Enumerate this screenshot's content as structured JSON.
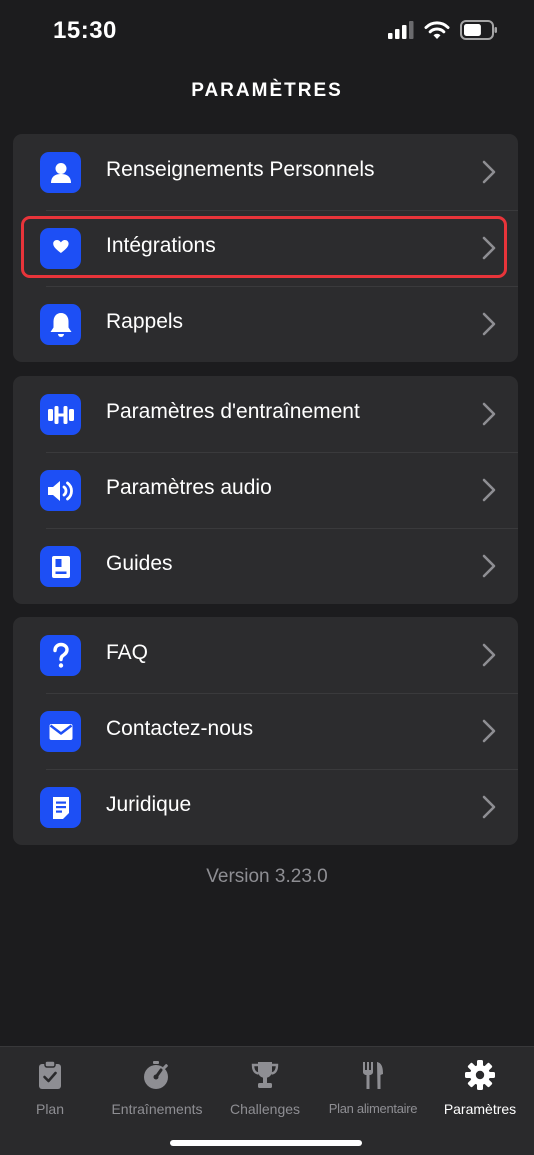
{
  "status_bar": {
    "time": "15:30",
    "icons": [
      "signal-icon",
      "wifi-icon",
      "battery-icon"
    ],
    "battery_level": 0.65
  },
  "header": {
    "title": "PARAMÈTRES"
  },
  "colors": {
    "background": "#1c1c1e",
    "card": "#2c2c2e",
    "icon_accent": "#1d4ff5",
    "highlight": "#e8343a",
    "muted_text": "#8e8e93"
  },
  "groups": [
    {
      "items": [
        {
          "label": "Renseignements Personnels",
          "icon": "person-icon"
        },
        {
          "label": "Intégrations",
          "icon": "heart-icon",
          "highlighted": true
        },
        {
          "label": "Rappels",
          "icon": "bell-icon"
        }
      ]
    },
    {
      "items": [
        {
          "label": "Paramètres d'entraînement",
          "icon": "dumbbell-icon"
        },
        {
          "label": "Paramètres audio",
          "icon": "speaker-icon"
        },
        {
          "label": "Guides",
          "icon": "book-icon"
        }
      ]
    },
    {
      "items": [
        {
          "label": "FAQ",
          "icon": "question-icon"
        },
        {
          "label": "Contactez-nous",
          "icon": "envelope-icon"
        },
        {
          "label": "Juridique",
          "icon": "document-icon"
        }
      ]
    }
  ],
  "version": "Version 3.23.0",
  "tab_bar": {
    "tabs": [
      {
        "label": "Plan",
        "icon": "clipboard-icon",
        "active": false
      },
      {
        "label": "Entraînements",
        "icon": "stopwatch-icon",
        "active": false
      },
      {
        "label": "Challenges",
        "icon": "trophy-icon",
        "active": false
      },
      {
        "label": "Plan alimentaire",
        "icon": "fork-knife-icon",
        "active": false
      },
      {
        "label": "Paramètres",
        "icon": "gear-icon",
        "active": true
      }
    ]
  }
}
